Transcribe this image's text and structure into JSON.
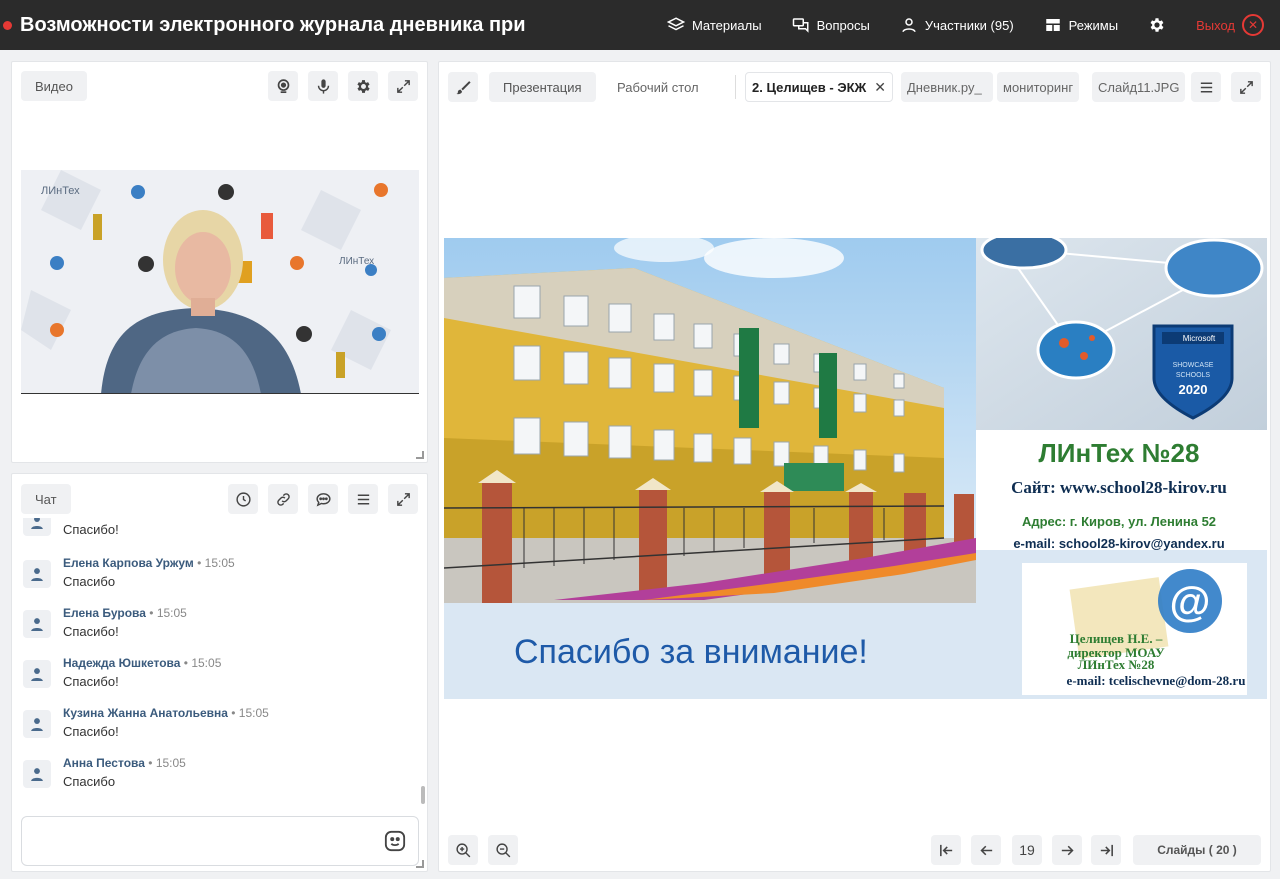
{
  "header": {
    "title": "Возможности электронного журнала дневника при",
    "nav": {
      "materials": "Материалы",
      "questions": "Вопросы",
      "participants": "Участники (95)",
      "modes": "Режимы",
      "exit": "Выход"
    }
  },
  "video": {
    "tab_label": "Видео"
  },
  "chat": {
    "tab_label": "Чат",
    "messages": [
      {
        "author": "",
        "time": "",
        "text": "Спасибо!"
      },
      {
        "author": "Елена Карпова Уржум",
        "time": "• 15:05",
        "text": "Спасибо"
      },
      {
        "author": "Елена Бурова",
        "time": "• 15:05",
        "text": "Спасибо!"
      },
      {
        "author": "Надежда Юшкетова",
        "time": "• 15:05",
        "text": "Спасибо!"
      },
      {
        "author": "Кузина Жанна Анатольевна",
        "time": "• 15:05",
        "text": "Спасибо!"
      },
      {
        "author": "Анна Пестова",
        "time": "• 15:05",
        "text": "Спасибо"
      }
    ]
  },
  "presentation": {
    "tabs": [
      "Презентация",
      "Рабочий стол",
      "2. Целищев - ЭКЖ",
      "Дневник.ру_",
      "мониторинг",
      "Слайд11.JPG"
    ],
    "slide": {
      "title": "ЛИнТех №28",
      "site": "Сайт: www.school28-kirov.ru",
      "address": "Адрес: г. Киров, ул. Ленина 52",
      "email": "e-mail: school28-kirov@yandex.ru",
      "thanks": "Спасибо за внимание!",
      "author_line1": "Целищев Н.Е. –",
      "author_line2": "директор МОАУ",
      "author_line3": "ЛИнТех №28",
      "author_email": "e-mail: tcelischevne@dom-28.ru",
      "badge_brand": "Microsoft",
      "badge_line1": "SHOWCASE",
      "badge_line2": "SCHOOLS",
      "badge_year": "2020"
    },
    "page": "19",
    "slides_label": "Слайды ( 20 )"
  },
  "colors": {
    "topbar": "#2b2b2b",
    "accent_red": "#e53935",
    "author_blue": "#3b5b7d",
    "slide_title_green": "#2e7d32",
    "thanks_blue": "#1e5aa8"
  }
}
